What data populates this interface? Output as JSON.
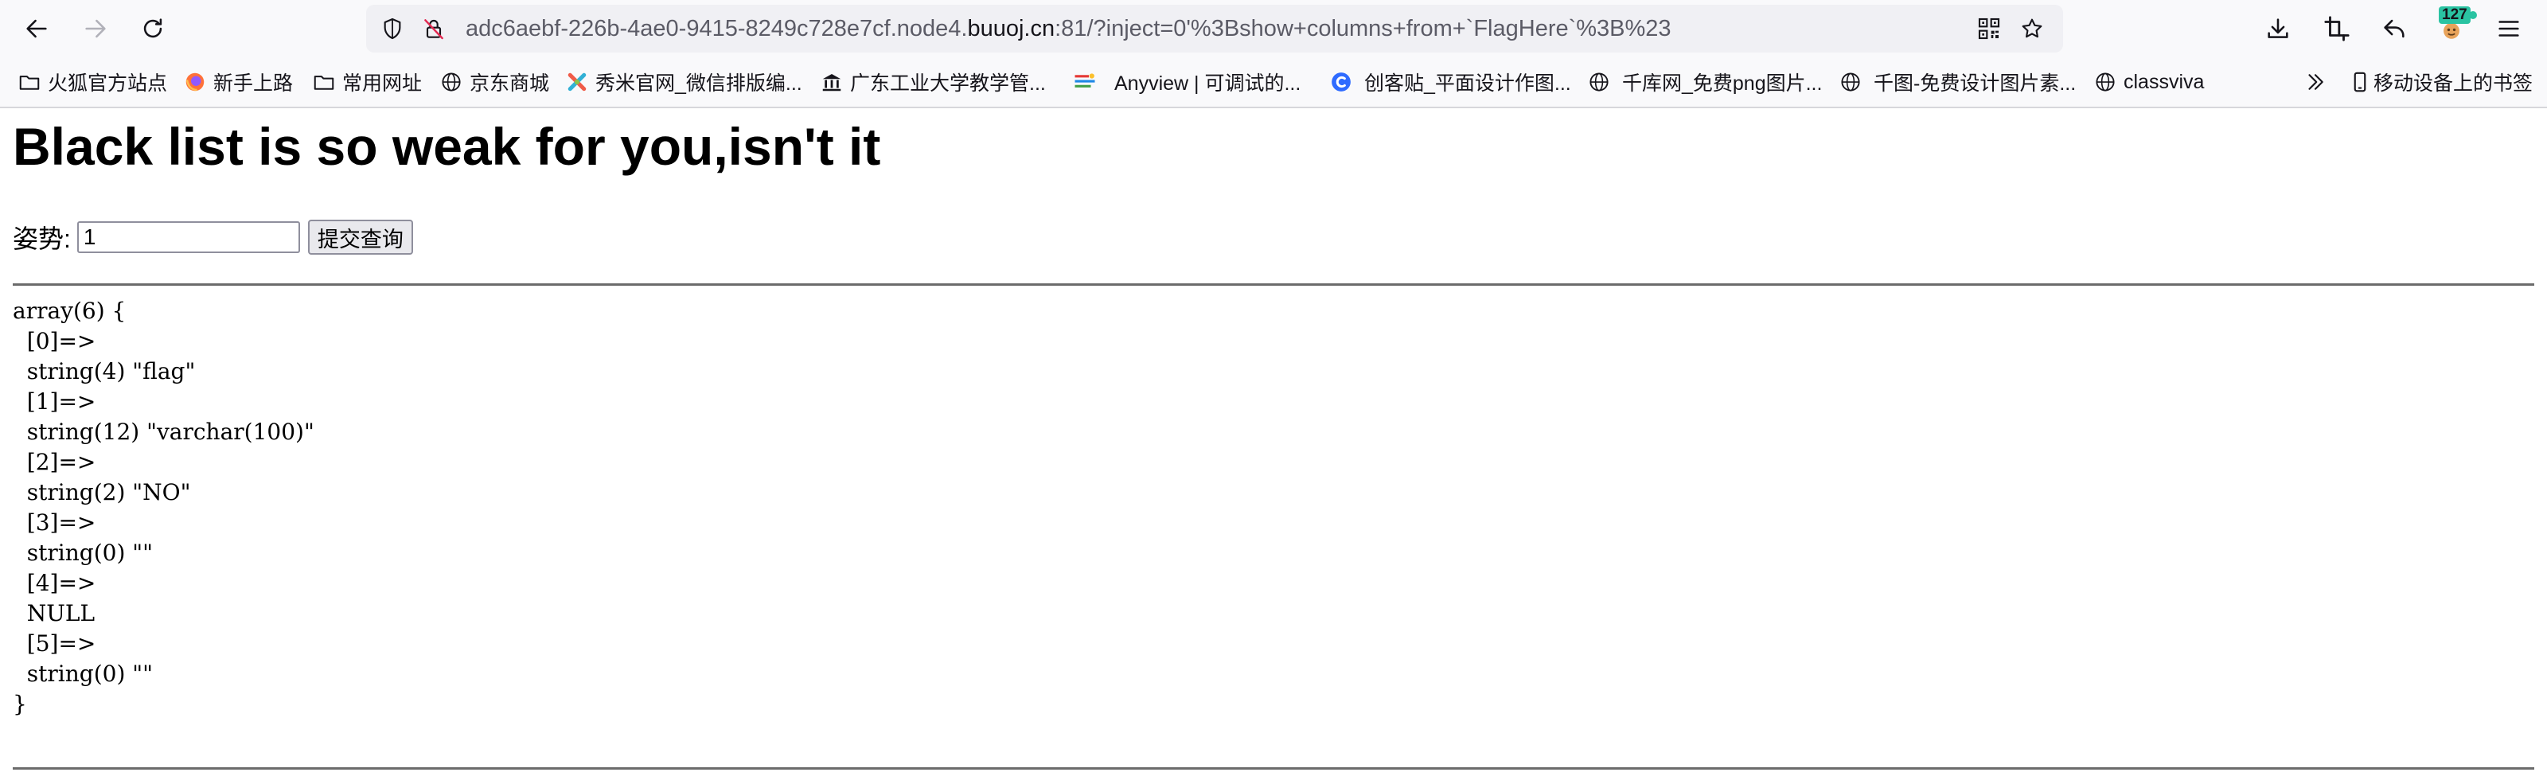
{
  "browser": {
    "url": {
      "prefix": "adc6aebf-226b-4ae0-9415-8249c728e7cf.node4.",
      "domain": "buuoj.cn",
      "suffix": ":81/?inject=0'%3Bshow+columns+from+`FlagHere`%3B%23"
    },
    "extension_badge": "127",
    "icons": {
      "back": "back-arrow-icon",
      "forward": "forward-arrow-icon",
      "reload": "reload-icon",
      "shield": "tracking-protection-shield-icon",
      "insecure": "insecure-connection-icon",
      "qr": "qr-code-icon",
      "bookmark": "star-icon",
      "downloads": "download-icon",
      "screenshot": "crop-icon",
      "undo": "undo-icon",
      "extension": "extension-icon",
      "menu": "hamburger-menu-icon"
    }
  },
  "bookmarks": {
    "items": [
      {
        "label": "火狐官方站点",
        "icon": "folder-icon"
      },
      {
        "label": "新手上路",
        "icon": "firefox-icon"
      },
      {
        "label": "常用网址",
        "icon": "folder-icon"
      },
      {
        "label": "京东商城",
        "icon": "globe-icon"
      },
      {
        "label": "秀米官网_微信排版编...",
        "icon": "xiumi-icon"
      },
      {
        "label": "广东工业大学教学管...",
        "icon": "university-icon"
      },
      {
        "label": "Anyview | 可调试的...",
        "icon": "anyview-icon"
      },
      {
        "label": "创客贴_平面设计作图...",
        "icon": "chuangketie-icon"
      },
      {
        "label": "千库网_免费png图片...",
        "icon": "globe-icon"
      },
      {
        "label": "千图-免费设计图片素...",
        "icon": "globe-icon"
      },
      {
        "label": "classviva",
        "icon": "globe-icon"
      }
    ],
    "overflow": "chevron-double-right-icon",
    "mobile_label": "移动设备上的书签",
    "mobile_icon": "mobile-device-icon"
  },
  "page": {
    "title": "Black list is so weak for you,isn't it",
    "form": {
      "label": "姿势:",
      "input_value": "1",
      "submit_label": "提交查询"
    },
    "dump": "array(6) {\n  [0]=>\n  string(4) \"flag\"\n  [1]=>\n  string(12) \"varchar(100)\"\n  [2]=>\n  string(2) \"NO\"\n  [3]=>\n  string(0) \"\"\n  [4]=>\n  NULL\n  [5]=>\n  string(0) \"\"\n}"
  }
}
